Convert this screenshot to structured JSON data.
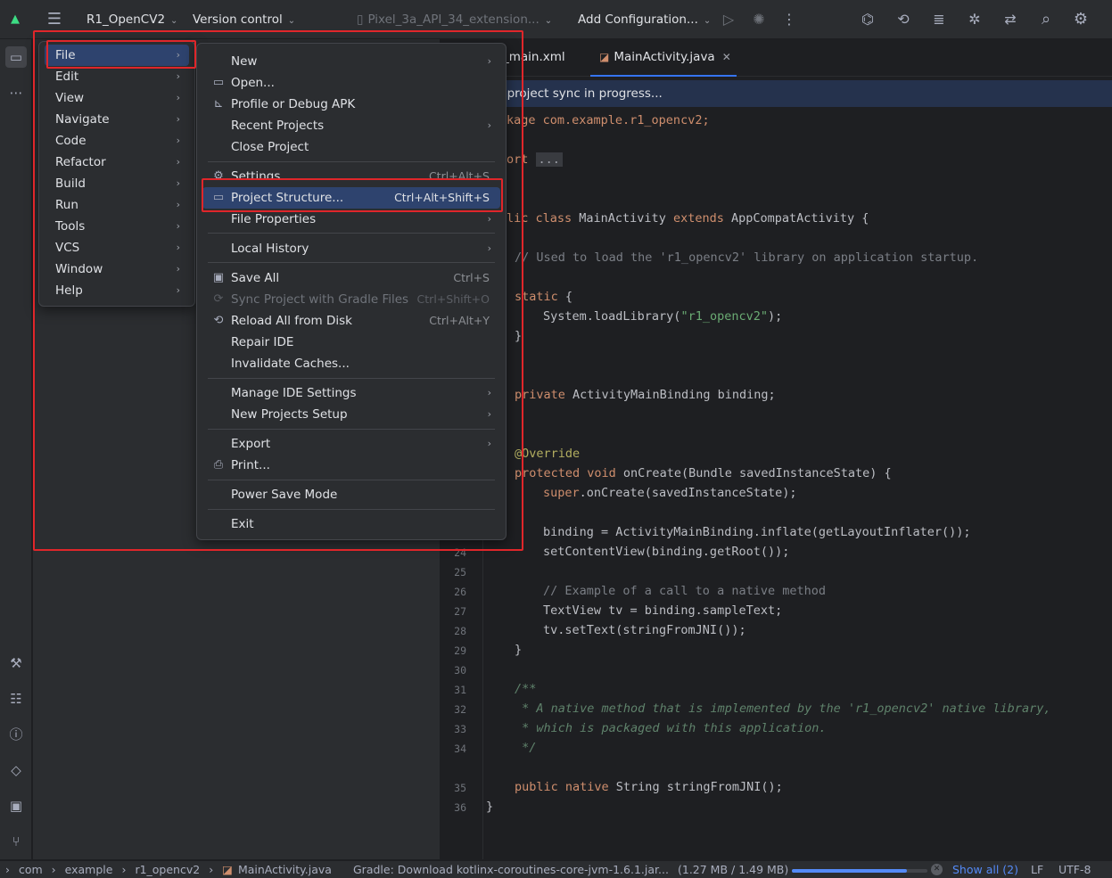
{
  "titlebar": {
    "project_name": "R1_OpenCV2",
    "vcs_label": "Version control",
    "device": "Pixel_3a_API_34_extension...",
    "config": "Add Configuration..."
  },
  "editor": {
    "tabs": [
      {
        "label": "_main.xml"
      },
      {
        "label": "MainActivity.java"
      }
    ],
    "sync_message": "e project sync in progress...",
    "line_numbers": [
      "24",
      "25",
      "26",
      "27",
      "28",
      "29",
      "30",
      "31",
      "32",
      "33",
      "34",
      "35",
      "36"
    ],
    "code": {
      "l_package": "kage com.example.r1_opencv2;",
      "l_import_kw": "ort",
      "l_import_fold": "...",
      "l_class_kw": "lic class",
      "l_class_name": " MainActivity ",
      "l_class_ext": "extends",
      "l_class_rest": " AppCompatActivity {",
      "l_comment": "// Used to load the 'r1_opencv2' library on application startup.",
      "l_static": "static",
      "l_static_brace": " {",
      "l_load_pre": "System.loadLibrary(",
      "l_load_str": "\"r1_opencv2\"",
      "l_load_post": ");",
      "l_close1": "}",
      "l_private": "private",
      "l_binding": " ActivityMainBinding binding;",
      "l_override": "@Override",
      "l_protected": "protected void",
      "l_oncreate": " onCreate(Bundle savedInstanceState) {",
      "l_super": "super",
      "l_super_rest": ".onCreate(savedInstanceState);",
      "l_inflate": "binding = ActivityMainBinding.inflate(getLayoutInflater());",
      "l_setcontent": "setContentView(binding.getRoot());",
      "l_example": "// Example of a call to a native method",
      "l_textview": "TextView tv = binding.sampleText;",
      "l_settext": "tv.setText(stringFromJNI());",
      "l_close2": "}",
      "l_doc1": "/**",
      "l_doc2": " * A native method that is implemented by the 'r1_opencv2' native library,",
      "l_doc3": " * which is packaged with this application.",
      "l_doc4": " */",
      "l_public_native": "public native",
      "l_native_rest": " String stringFromJNI();",
      "l_close3": "}"
    }
  },
  "main_menu": {
    "items": [
      {
        "label": "File"
      },
      {
        "label": "Edit"
      },
      {
        "label": "View"
      },
      {
        "label": "Navigate"
      },
      {
        "label": "Code"
      },
      {
        "label": "Refactor"
      },
      {
        "label": "Build"
      },
      {
        "label": "Run"
      },
      {
        "label": "Tools"
      },
      {
        "label": "VCS"
      },
      {
        "label": "Window"
      },
      {
        "label": "Help"
      }
    ]
  },
  "file_menu": {
    "new": "New",
    "open": "Open...",
    "profile_apk": "Profile or Debug APK",
    "recent_projects": "Recent Projects",
    "close_project": "Close Project",
    "settings": "Settings",
    "settings_shortcut": "Ctrl+Alt+S",
    "project_structure": "Project Structure...",
    "project_structure_shortcut": "Ctrl+Alt+Shift+S",
    "file_properties": "File Properties",
    "local_history": "Local History",
    "save_all": "Save All",
    "save_all_shortcut": "Ctrl+S",
    "sync_gradle": "Sync Project with Gradle Files",
    "sync_gradle_shortcut": "Ctrl+Shift+O",
    "reload_disk": "Reload All from Disk",
    "reload_disk_shortcut": "Ctrl+Alt+Y",
    "repair_ide": "Repair IDE",
    "invalidate_caches": "Invalidate Caches...",
    "manage_ide_settings": "Manage IDE Settings",
    "new_projects_setup": "New Projects Setup",
    "export": "Export",
    "print": "Print...",
    "power_save": "Power Save Mode",
    "exit": "Exit"
  },
  "statusbar": {
    "crumb1": "com",
    "crumb2": "example",
    "crumb3": "r1_opencv2",
    "crumb4": "MainActivity.java",
    "gradle": "Gradle: Download kotlinx-coroutines-core-jvm-1.6.1.jar...",
    "size": "(1.27 MB / 1.49 MB)",
    "progress": 0.85,
    "show_all": "Show all (2)",
    "line_ending": "LF",
    "encoding": "UTF-8"
  },
  "colors": {
    "accent": "#3574f0",
    "selection": "#2e436e",
    "highlight_box": "#e0262a"
  }
}
